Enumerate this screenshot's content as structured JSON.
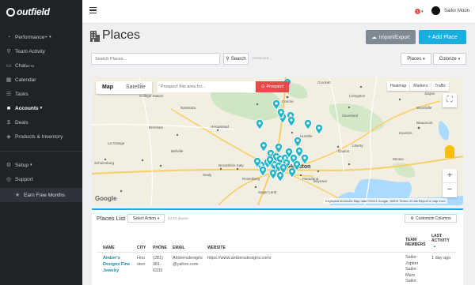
{
  "app": {
    "logo_text": "outfield"
  },
  "sidebar": {
    "items": [
      {
        "label": "Performance+",
        "icon": "gauge-icon",
        "caret": "▾"
      },
      {
        "label": "Team Activity",
        "icon": "location-pin-icon"
      },
      {
        "label": "Chat",
        "sup": "BETA",
        "icon": "chat-bubble-icon"
      },
      {
        "label": "Calendar",
        "icon": "calendar-icon"
      },
      {
        "label": "Tasks",
        "icon": "tasks-icon"
      },
      {
        "label": "Accounts",
        "icon": "briefcase-icon",
        "caret": "▾"
      },
      {
        "label": "Deals",
        "icon": "dollar-icon"
      },
      {
        "label": "Products & Inventory",
        "icon": "tag-icon"
      }
    ],
    "bottom_items": [
      {
        "label": "Setup",
        "icon": "gear-icon",
        "caret": "▾"
      },
      {
        "label": "Support",
        "icon": "support-icon"
      },
      {
        "label": "Earn Free Months",
        "icon": "star-icon"
      }
    ]
  },
  "topbar": {
    "notification_count": "1",
    "notification_caret": "▾",
    "user_name": "Sailor Moon"
  },
  "header": {
    "title": "Places",
    "import_label": "Import/Export",
    "add_label": "+ Add Place"
  },
  "search": {
    "placeholder": "Search Places...",
    "button_label": "Search",
    "advanced_label": "Advanced",
    "places_label": "Places",
    "colorize_label": "Colorize",
    "dropdown_caret": "▾"
  },
  "map": {
    "tabs": [
      "Map",
      "Satellite"
    ],
    "active_tab": "Map",
    "prospect_placeholder": "Prospect this area for...",
    "prospect_label": "Prospect",
    "options": [
      "Heatmap",
      "Markers",
      "Traffic"
    ],
    "google_label": "Google",
    "attribution": "Keyboard shortcuts   Map data ©2021 Google, INEGI   Terms of Use   Report a map error",
    "pin_color": "#22b5c9",
    "city_labels": {
      "conroe": "Conroe",
      "houston": "Houston",
      "pasadena": "Pasadena",
      "baytown": "Baytown",
      "sugar_land": "Sugar Land",
      "humble": "Humble",
      "beaumont": "Beaumont",
      "brookshire": "Brookshire Katy",
      "sealy": "Sealy",
      "hempstead": "Hempstead",
      "navasota": "Navasota",
      "huntsville": "Huntsville",
      "cleveland": "Cleveland",
      "liberty": "Liberty",
      "dayton": "Dayton",
      "schulenburg": "Schulenburg",
      "brenham": "Brenham",
      "bellville": "Bellville",
      "lufkin": "Lufkin",
      "livingston": "Livingston",
      "jasper": "Jasper",
      "rosenberg": "Rosenberg",
      "college_station": "College Station",
      "woodville": "Woodville",
      "kountze": "Kountze",
      "winnie": "Winnie",
      "crockett": "Crockett",
      "la_grange": "La Grange"
    }
  },
  "places_list": {
    "title": "Places List",
    "select_action_label": "Select Action",
    "count_text": "for 51 places",
    "customize_label": "Customize Columns",
    "columns": {
      "name": "NAME",
      "city": "CITY",
      "phone": "PHONE",
      "email": "EMAIL",
      "website": "WEBSITE",
      "team_members": "TEAM MEMBERS",
      "last_activity": "LAST ACTIVITY",
      "sort_indicator": "▲"
    },
    "rows": [
      {
        "name": "Amber's Designs Fine Jewelry",
        "city": "Houston",
        "phone": "(281) 381-6333",
        "email": "Ambersdesigns@yahoo.com",
        "website": "https://www.ambersdesigns.com/",
        "team_members": "Sailor Jupiter Sailor Mars Sailor",
        "last_activity": "1 day ago"
      }
    ]
  }
}
